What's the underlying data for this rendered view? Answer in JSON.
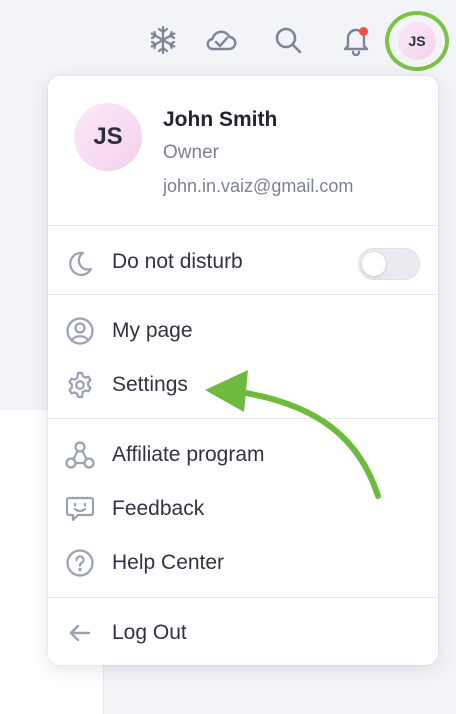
{
  "topbar": {
    "icons": [
      "snowflake-icon",
      "cloud-check-icon",
      "search-icon",
      "bell-icon"
    ],
    "notification_dot_color": "#ff4d3d",
    "avatar_initials": "JS",
    "highlight_color": "#7cc243"
  },
  "profile": {
    "initials": "JS",
    "name": "John Smith",
    "role": "Owner",
    "email": "john.in.vaiz@gmail.com"
  },
  "menu": {
    "do_not_disturb": {
      "label": "Do not disturb",
      "icon": "moon-icon",
      "enabled": false
    },
    "my_page": {
      "label": "My page",
      "icon": "user-circle-icon"
    },
    "settings": {
      "label": "Settings",
      "icon": "gear-icon"
    },
    "affiliate": {
      "label": "Affiliate program",
      "icon": "network-icon"
    },
    "feedback": {
      "label": "Feedback",
      "icon": "feedback-icon"
    },
    "help_center": {
      "label": "Help Center",
      "icon": "help-icon"
    },
    "log_out": {
      "label": "Log Out",
      "icon": "arrow-left-icon"
    }
  },
  "annotation": {
    "arrow_color": "#6dbb3e",
    "points_to": "settings"
  }
}
